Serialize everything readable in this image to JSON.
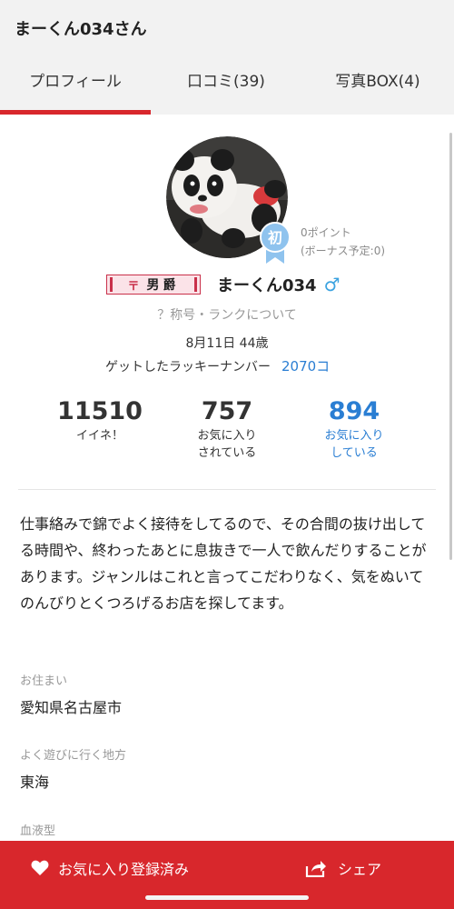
{
  "header": {
    "title": "まーくん034さん"
  },
  "tabs": [
    {
      "label": "プロフィール",
      "active": true
    },
    {
      "label": "口コミ(39)",
      "active": false
    },
    {
      "label": "写真BOX(4)",
      "active": false
    }
  ],
  "profile": {
    "rank_badge_char": "初",
    "points": "0ポイント",
    "bonus": "(ボーナス予定:0)",
    "title_badge_mark": "〒",
    "title_badge_text": "男爵",
    "username": "まーくん034",
    "gender_symbol": "♂",
    "rank_link": "？称号・ランクについて",
    "birthday": "8月11日 44歳",
    "lucky_label": "ゲットしたラッキーナンバー",
    "lucky_value": "2070コ"
  },
  "stats": [
    {
      "value": "11510",
      "label_line1": "イイネ！",
      "label_line2": ""
    },
    {
      "value": "757",
      "label_line1": "お気に入り",
      "label_line2": "されている"
    },
    {
      "value": "894",
      "label_line1": "お気に入り",
      "label_line2": "している"
    }
  ],
  "intro": "仕事絡みで錦でよく接待をしてるので、その合間の抜け出してる時間や、終わったあとに息抜きで一人で飲んだりすることがあります。ジャンルはこれと言ってこだわりなく、気をぬいてのんびりとくつろげるお店を探してます。",
  "fields": [
    {
      "label": "お住まい",
      "value": "愛知県名古屋市"
    },
    {
      "label": "よく遊びに行く地方",
      "value": "東海"
    },
    {
      "label": "血液型",
      "value": ""
    }
  ],
  "bottom_bar": {
    "favorite_label": "お気に入り登録済み",
    "share_label": "シェア"
  },
  "colors": {
    "accent_red": "#d8272c",
    "link_blue": "#2a7ed3",
    "gender_blue": "#3ca3e0",
    "badge_blue": "#8fc3ee"
  },
  "icons": {
    "avatar": "panda-figure-avatar",
    "rank_badge": "beginner-rank-badge-icon",
    "gender": "male-symbol-icon",
    "favorite": "heart-icon",
    "share": "share-icon"
  }
}
